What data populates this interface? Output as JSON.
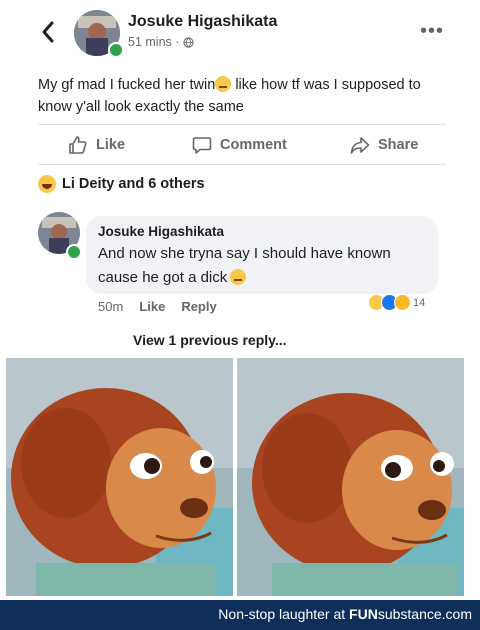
{
  "post": {
    "author": "Josuke Higashikata",
    "time": "51 mins ·",
    "text": "My gf mad I fucked her twin",
    "text_cont": " like how tf was I supposed to know y'all look exactly the same",
    "actions": {
      "like": "Like",
      "comment": "Comment",
      "share": "Share"
    },
    "reactions_summary": "Li Deity and 6 others"
  },
  "comment": {
    "author": "Josuke Higashikata",
    "text": "And now she tryna say I should have known cause he got a dick",
    "time": "50m",
    "like": "Like",
    "reply": "Reply",
    "reaction_count": "14"
  },
  "view_previous": "View 1 previous reply...",
  "icons": {
    "back": "chevron-left-icon",
    "more": "more-dots-icon",
    "globe": "globe-icon",
    "like": "thumbs-up-icon",
    "comment": "comment-bubble-icon",
    "share": "share-arrow-icon"
  },
  "footer": {
    "prefix": "Non-stop laughter at",
    "brand_bold": "FUN",
    "brand_mid": "substance",
    "brand_end": ".com"
  },
  "colors": {
    "online": "#31a24c",
    "meta": "#65676b",
    "bubble": "#f0f2f5",
    "footer_bg": "#0d2f5a",
    "monkey_fur": "#a8441f",
    "monkey_face": "#d98a4a",
    "background_teal": "#6fb7c3"
  }
}
